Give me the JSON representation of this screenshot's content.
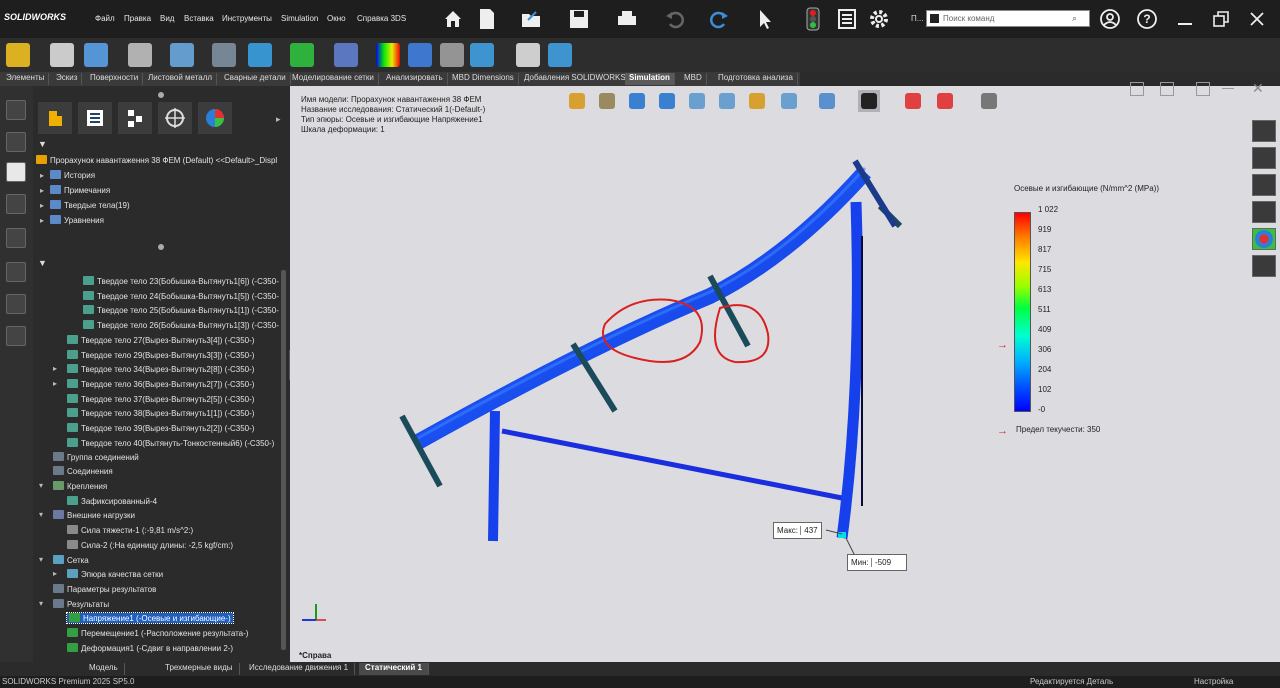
{
  "app": {
    "logo": "SOLIDWORKS",
    "version_status": "SOLIDWORKS Premium 2025 SP5.0"
  },
  "menu": [
    "Файл",
    "Правка",
    "Вид",
    "Вставка",
    "Инструменты",
    "Simulation",
    "Окно",
    "Справка 3DS"
  ],
  "title_short": "П...",
  "search": {
    "placeholder": "Поиск команд"
  },
  "command_tabs": [
    {
      "label": "Элементы",
      "active": false
    },
    {
      "label": "Эскиз",
      "active": false
    },
    {
      "label": "Поверхности",
      "active": false
    },
    {
      "label": "Листовой металл",
      "active": false
    },
    {
      "label": "Сварные детали",
      "active": false
    },
    {
      "label": "Моделирование сетки",
      "active": false
    },
    {
      "label": "Анализировать",
      "active": false
    },
    {
      "label": "MBD Dimensions",
      "active": false
    },
    {
      "label": "Добавления SOLIDWORKS",
      "active": false
    },
    {
      "label": "Simulation",
      "active": true
    },
    {
      "label": "MBD",
      "active": false
    },
    {
      "label": "Подготовка анализа",
      "active": false
    }
  ],
  "tree_top": {
    "root": "Прорахунок навантаження 38 ФЕМ (Default) <<Default>_Displ",
    "items": [
      "История",
      "Примечания",
      "Твердые тела(19)",
      "Уравнения"
    ]
  },
  "tree_bottom": {
    "bodies": [
      "Твердое тело 23(Бобышка-Вытянуть1[6]) (-С350-",
      "Твердое тело 24(Бобышка-Вытянуть1[5]) (-С350-",
      "Твердое тело 25(Бобышка-Вытянуть1[1]) (-С350-",
      "Твердое тело 26(Бобышка-Вытянуть1[3]) (-С350-",
      "Твердое тело 27(Вырез-Вытянуть3[4]) (-С350-)",
      "Твердое тело 29(Вырез-Вытянуть3[3]) (-С350-)",
      "Твердое тело 34(Вырез-Вытянуть2[8]) (-С350-)",
      "Твердое тело 36(Вырез-Вытянуть2[7]) (-С350-)",
      "Твердое тело 37(Вырез-Вытянуть2[5]) (-С350-)",
      "Твердое тело 38(Вырез-Вытянуть1[1]) (-С350-)",
      "Твердое тело 39(Вырез-Вытянуть2[2]) (-С350-)",
      "Твердое тело 40(Вытянуть-Тонкостенный6) (-С350-)"
    ],
    "connections_group": "Группа соединений",
    "connections": "Соединения",
    "fixtures": "Крепления",
    "fixed": "Зафиксированный-4",
    "loads": "Внешние нагрузки",
    "gravity": "Сила тяжести-1 (:-9,81 m/s^2:)",
    "force": "Сила-2 (:На единицу длины: -2,5 kgf/cm:)",
    "mesh": "Сетка",
    "mesh_quality": "Эпюра качества сетки",
    "result_options": "Параметры результатов",
    "results": "Результаты",
    "stress": "Напряжение1 (-Осевые и изгибающие-)",
    "displacement": "Перемещение1 (-Расположение результата-)",
    "strain": "Деформация1 (-Сдвиг в направлении 2-)"
  },
  "viewport": {
    "info": [
      "Имя модели: Прорахунок навантаження 38 ФЕМ",
      "Название исследования: Статический 1(-Default-)",
      "Тип эпюры: Осевые и изгибающие Напряжение1",
      "Шкала деформации: 1"
    ],
    "view_label": "*Справа"
  },
  "legend": {
    "title": "Осевые и изгибающие (N/mm^2 (MPa))",
    "values": [
      "1 022",
      "919",
      "817",
      "715",
      "613",
      "511",
      "409",
      "306",
      "204",
      "102",
      "-0"
    ],
    "yield_label": "Предел текучести: 350"
  },
  "callouts": {
    "max_label": "Макс:",
    "max_value": "437",
    "min_label": "Мин:",
    "min_value": "-509"
  },
  "bottom_tabs": [
    {
      "label": "Модель",
      "active": false
    },
    {
      "label": "Трехмерные виды",
      "active": false
    },
    {
      "label": "Исследование движения 1",
      "active": false
    },
    {
      "label": "Статический 1",
      "active": true
    }
  ],
  "status": {
    "editing": "Редактируется Деталь",
    "custom": "Настройка"
  }
}
